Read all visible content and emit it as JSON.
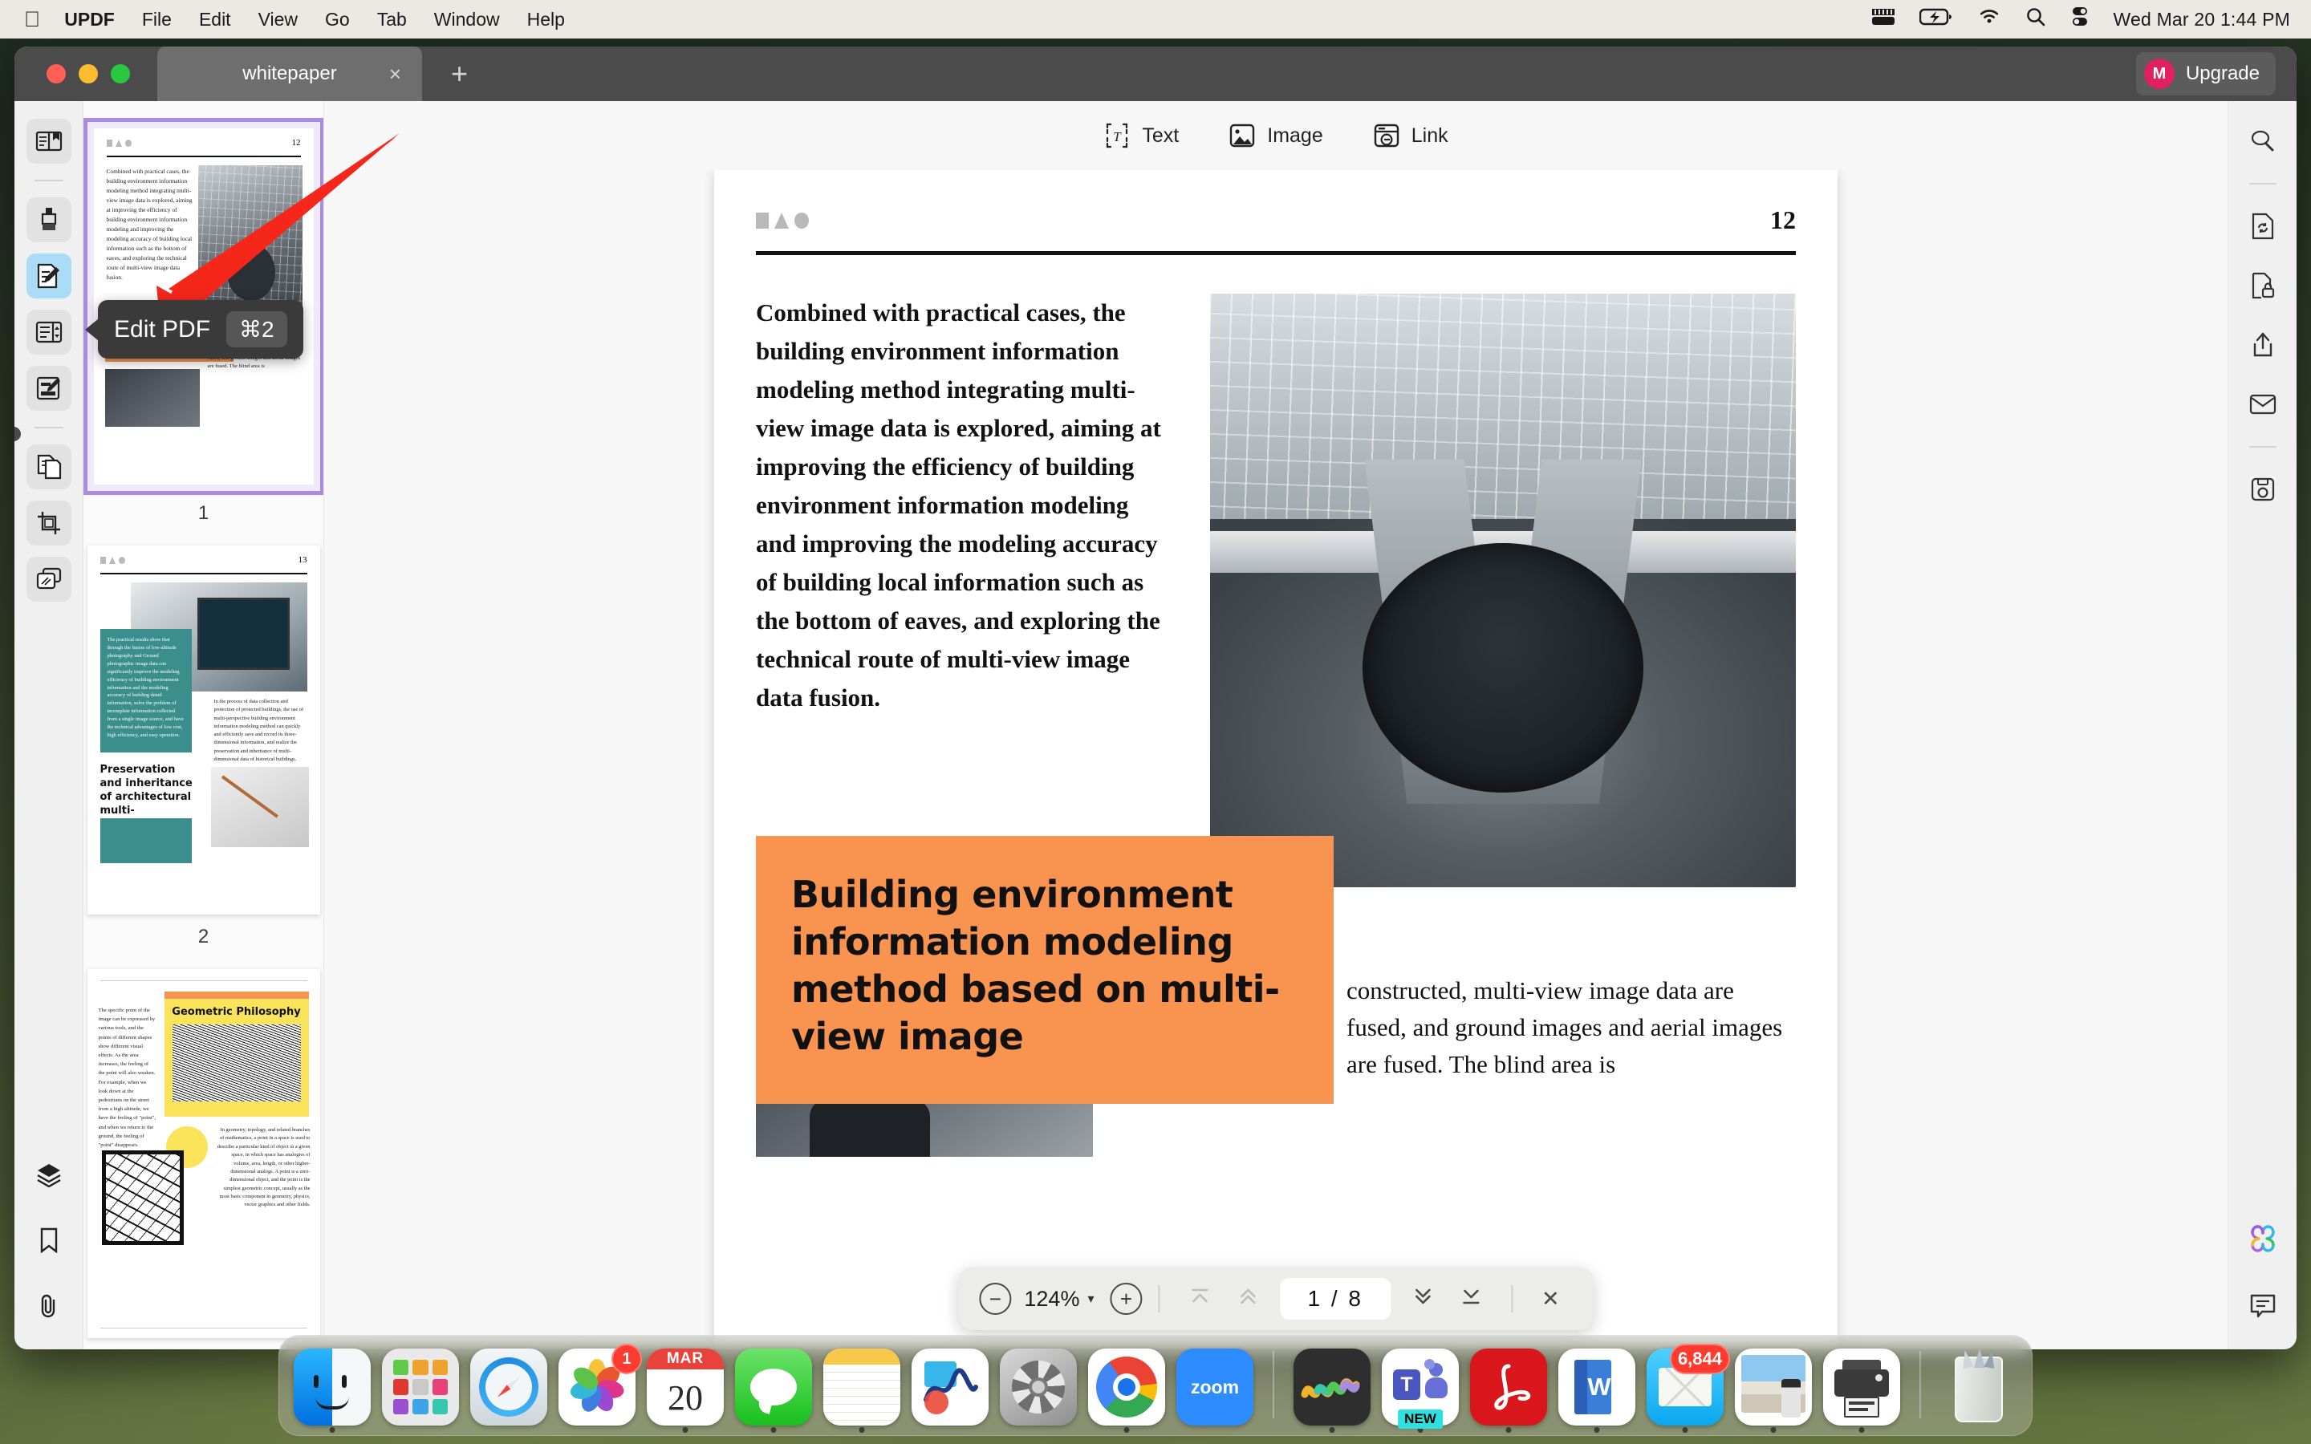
{
  "menubar": {
    "apple_icon": "apple-icon",
    "items": [
      {
        "label": "UPDF",
        "bold": true
      },
      {
        "label": "File"
      },
      {
        "label": "Edit"
      },
      {
        "label": "View"
      },
      {
        "label": "Go"
      },
      {
        "label": "Tab"
      },
      {
        "label": "Window"
      },
      {
        "label": "Help"
      }
    ],
    "status_icons": [
      "keyboard-icon",
      "battery-charging-icon",
      "wifi-icon",
      "search-icon",
      "control-center-icon"
    ],
    "clock": "Wed Mar 20  1:44 PM"
  },
  "titlebar": {
    "tab_title": "whitepaper",
    "tab_close": "×",
    "new_tab": "+",
    "avatar_initial": "M",
    "upgrade_label": "Upgrade"
  },
  "left_rail": {
    "items": [
      {
        "name": "reader-icon",
        "selected": false
      },
      {
        "name": "annotate-highlighter-icon",
        "selected": false
      },
      {
        "name": "edit-pdf-icon",
        "selected": true
      },
      {
        "name": "organize-pages-icon",
        "selected": false
      },
      {
        "name": "fill-and-sign-icon",
        "selected": false
      },
      {
        "name": "convert-pdf-icon",
        "selected": false
      },
      {
        "name": "crop-page-icon",
        "selected": false
      },
      {
        "name": "batch-process-icon",
        "selected": false
      }
    ],
    "bottom_items": [
      {
        "name": "layers-icon"
      },
      {
        "name": "bookmark-icon"
      },
      {
        "name": "attachment-icon"
      }
    ]
  },
  "tooltip": {
    "label": "Edit PDF",
    "shortcut": "⌘2"
  },
  "edit_toolbar": {
    "items": [
      {
        "label": "Text",
        "icon": "text-tool-icon"
      },
      {
        "label": "Image",
        "icon": "image-tool-icon"
      },
      {
        "label": "Link",
        "icon": "link-tool-icon"
      }
    ]
  },
  "thumbnails": [
    {
      "number": "1",
      "selected": true,
      "page_num": "12",
      "heading": "Building environment information modeling method based on multi-view image"
    },
    {
      "number": "2",
      "selected": false,
      "page_num": "13",
      "heading": "Preservation and inheritance of architectural multi-dimensional data"
    },
    {
      "number": "3",
      "selected": false,
      "page_num": "",
      "heading": "Geometric Philosophy"
    }
  ],
  "page": {
    "page_number": "12",
    "body_text": "Combined with practical cases, the building environment information modeling method integrating multi-view image data is explored, aiming at improving the efficiency of building environment information modeling and improving the modeling accuracy of building local information such as the bottom of eaves, and exploring the technical route of multi-view image data fusion.",
    "hero_heading": "Building environment information modeling method based on multi-view image",
    "lower_text": "constructed, multi-view image data are fused, and ground images and aerial images are fused. The blind area is"
  },
  "right_rail": {
    "items": [
      {
        "name": "search-icon"
      },
      {
        "name": "convert-ocr-icon"
      },
      {
        "name": "protect-document-icon"
      },
      {
        "name": "share-icon"
      },
      {
        "name": "email-icon"
      },
      {
        "name": "save-icon"
      }
    ],
    "bottom_items": [
      {
        "name": "ai-assistant-icon"
      },
      {
        "name": "comment-icon"
      }
    ]
  },
  "float_toolbar": {
    "zoom_out": "−",
    "zoom_level": "124%",
    "zoom_caret": "▾",
    "zoom_in": "+",
    "first_page_icon": "first-page-icon",
    "prev_page_icon": "previous-page-icon",
    "current_page": "1",
    "page_separator": "/",
    "total_pages": "8",
    "next_page_icon": "next-page-icon",
    "last_page_icon": "last-page-icon",
    "close": "✕"
  },
  "dock": {
    "apps": [
      {
        "name": "finder",
        "running": true
      },
      {
        "name": "launchpad",
        "running": false
      },
      {
        "name": "safari",
        "running": false
      },
      {
        "name": "photos",
        "running": false,
        "badge": "1"
      },
      {
        "name": "calendar",
        "running": true,
        "month": "MAR",
        "day": "20"
      },
      {
        "name": "messages",
        "running": true
      },
      {
        "name": "notes",
        "running": true
      },
      {
        "name": "freeform",
        "running": false
      },
      {
        "name": "system-settings",
        "running": false
      },
      {
        "name": "google-chrome",
        "running": true
      },
      {
        "name": "zoom",
        "running": false,
        "label": "zoom"
      },
      {
        "name": "arc-browser",
        "running": true
      },
      {
        "name": "microsoft-teams",
        "running": true,
        "new_badge": "NEW"
      },
      {
        "name": "adobe-acrobat",
        "running": true
      },
      {
        "name": "microsoft-word",
        "running": true
      },
      {
        "name": "mail",
        "running": true,
        "badge": "6,844"
      },
      {
        "name": "preview",
        "running": true
      },
      {
        "name": "printer-utility",
        "running": true
      },
      {
        "name": "trash",
        "running": false
      }
    ]
  },
  "colors": {
    "accent_orange": "#f89350",
    "selection_blue": "#aadcf7",
    "thumb_selected": "#a98ce0",
    "upgrade_pink": "#e0205f",
    "teal": "#3a8f8c",
    "yellow": "#fbe35a"
  }
}
